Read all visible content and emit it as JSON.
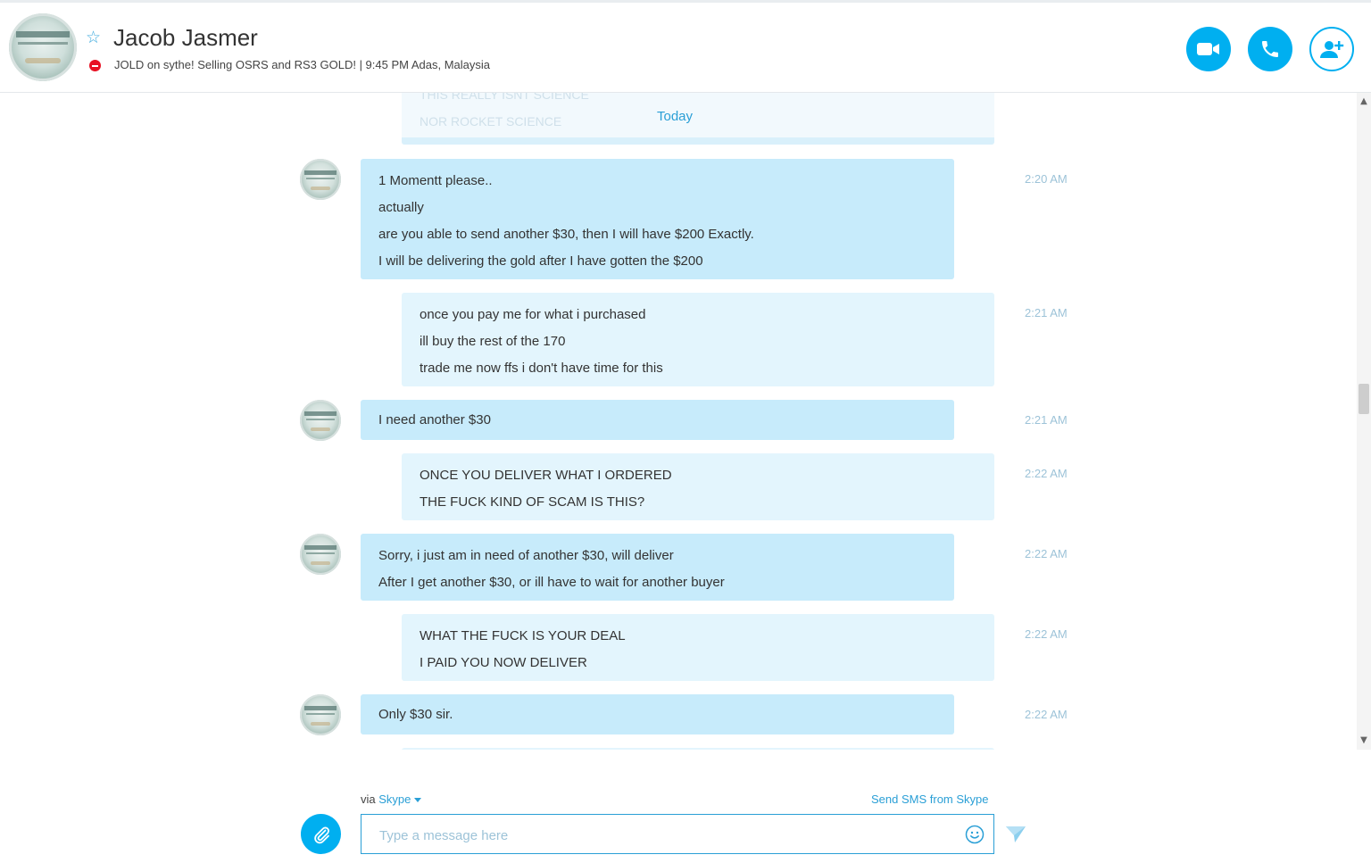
{
  "header": {
    "contact_name": "Jacob Jasmer",
    "mood": "JOLD on sythe! Selling OSRS and RS3 GOLD!  |  9:45 PM Adas, Malaysia",
    "status_icon": "do-not-disturb-icon",
    "buttons": [
      "video-call-icon",
      "audio-call-icon",
      "add-people-icon"
    ]
  },
  "conversation": {
    "day_divider": "Today",
    "faded_lines": [
      "THIS REALLY ISNT SCIENCE",
      "NOR ROCKET SCIENCE"
    ],
    "messages": [
      {
        "direction": "in",
        "time": "2:20 AM",
        "lines": [
          "1 Momentt please..",
          "actually",
          "are you able to send another $30, then I will have $200 Exactly.",
          "I will be delivering the gold after I have gotten the $200"
        ]
      },
      {
        "direction": "out",
        "time": "2:21 AM",
        "lines": [
          "once you pay me for what i purchased",
          "ill buy the rest of the 170",
          "trade me now ffs i don't have time for this"
        ]
      },
      {
        "direction": "in",
        "time": "2:21 AM",
        "lines": [
          "I need another $30"
        ]
      },
      {
        "direction": "out",
        "time": "2:22 AM",
        "lines": [
          "ONCE YOU DELIVER WHAT I ORDERED",
          "THE FUCK KIND OF SCAM IS THIS?"
        ]
      },
      {
        "direction": "in",
        "time": "2:22 AM",
        "lines": [
          "Sorry, i just am in need of another $30, will deliver",
          "After I get another $30, or ill have to wait for another buyer"
        ]
      },
      {
        "direction": "out",
        "time": "2:22 AM",
        "lines": [
          "WHAT THE FUCK IS YOUR DEAL",
          "I PAID YOU NOW DELIVER"
        ]
      },
      {
        "direction": "in",
        "time": "2:22 AM",
        "lines": [
          "Only $30 sir."
        ]
      }
    ]
  },
  "composer": {
    "via_prefix": "via",
    "via_service": "Skype",
    "sms_link": "Send SMS from Skype",
    "placeholder": "Type a message here",
    "value": ""
  },
  "colors": {
    "accent": "#00aff0",
    "incoming_bubble": "#c7ebfb",
    "outgoing_bubble": "#e3f5fd",
    "timestamp": "#9dc3d8",
    "link": "#2a9fd6",
    "status_dnd": "#e81123"
  }
}
